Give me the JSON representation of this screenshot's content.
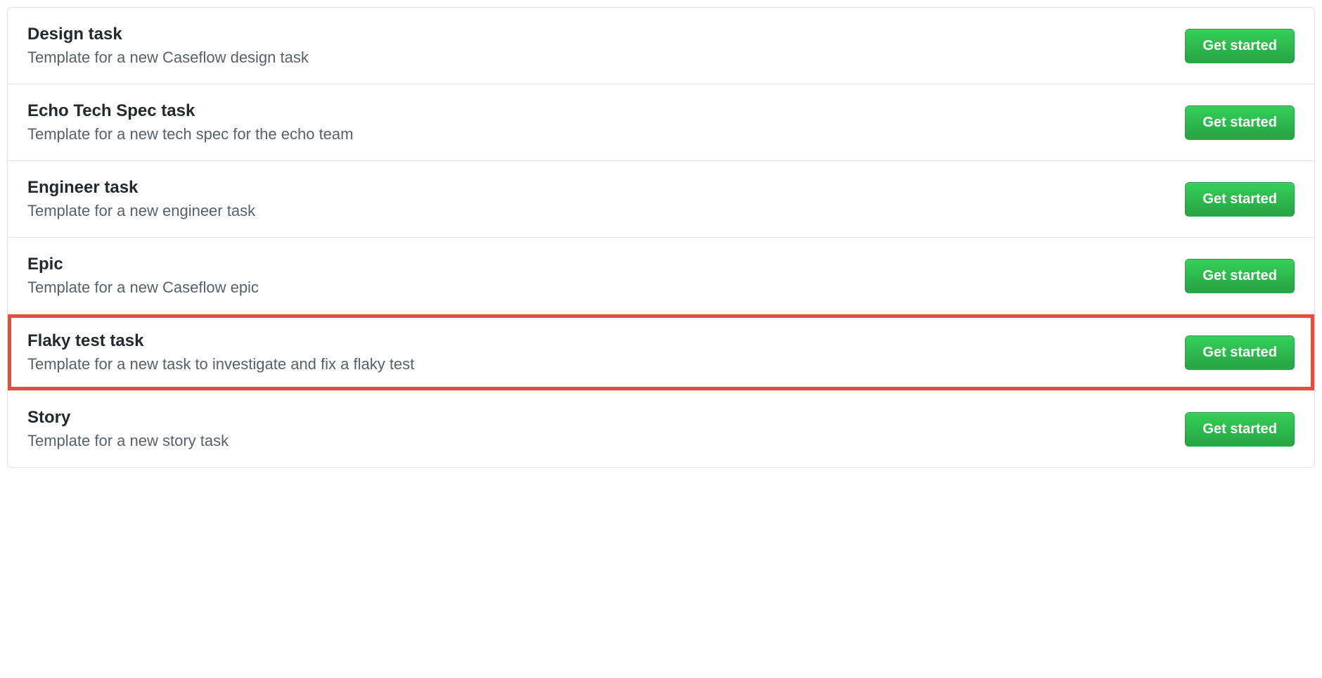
{
  "button_label": "Get started",
  "templates": [
    {
      "title": "Design task",
      "description": "Template for a new Caseflow design task",
      "highlighted": false
    },
    {
      "title": "Echo Tech Spec task",
      "description": "Template for a new tech spec for the echo team",
      "highlighted": false
    },
    {
      "title": "Engineer task",
      "description": "Template for a new engineer task",
      "highlighted": false
    },
    {
      "title": "Epic",
      "description": "Template for a new Caseflow epic",
      "highlighted": false
    },
    {
      "title": "Flaky test task",
      "description": "Template for a new task to investigate and fix a flaky test",
      "highlighted": true
    },
    {
      "title": "Story",
      "description": "Template for a new story task",
      "highlighted": false
    }
  ]
}
